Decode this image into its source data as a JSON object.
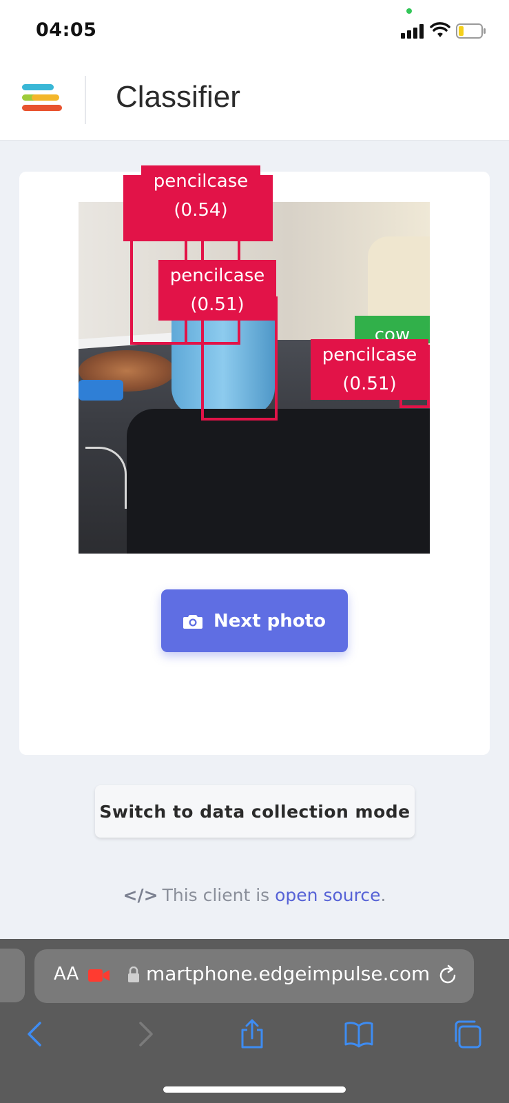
{
  "status_bar": {
    "time": "04:05"
  },
  "header": {
    "title": "Classifier"
  },
  "detections": [
    {
      "label": "pencilcase",
      "score": "(0.54)"
    },
    {
      "label": "pencilcase",
      "score": "(0.51)"
    },
    {
      "label": "cow",
      "score": ""
    },
    {
      "label": "pencilcase",
      "score": "(0.51)"
    }
  ],
  "detection_colors": {
    "pencilcase": "#e21348",
    "cow": "#31b04a"
  },
  "actions": {
    "next_photo_label": "Next photo",
    "switch_mode_label": "Switch to data collection mode"
  },
  "footer": {
    "prefix": "This client is ",
    "link_text": "open source",
    "suffix": "."
  },
  "browser": {
    "aa_label": "AA",
    "url": "martphone.edgeimpulse.com"
  },
  "theme": {
    "accent": "#5f6ee3",
    "link": "#5662d6"
  }
}
